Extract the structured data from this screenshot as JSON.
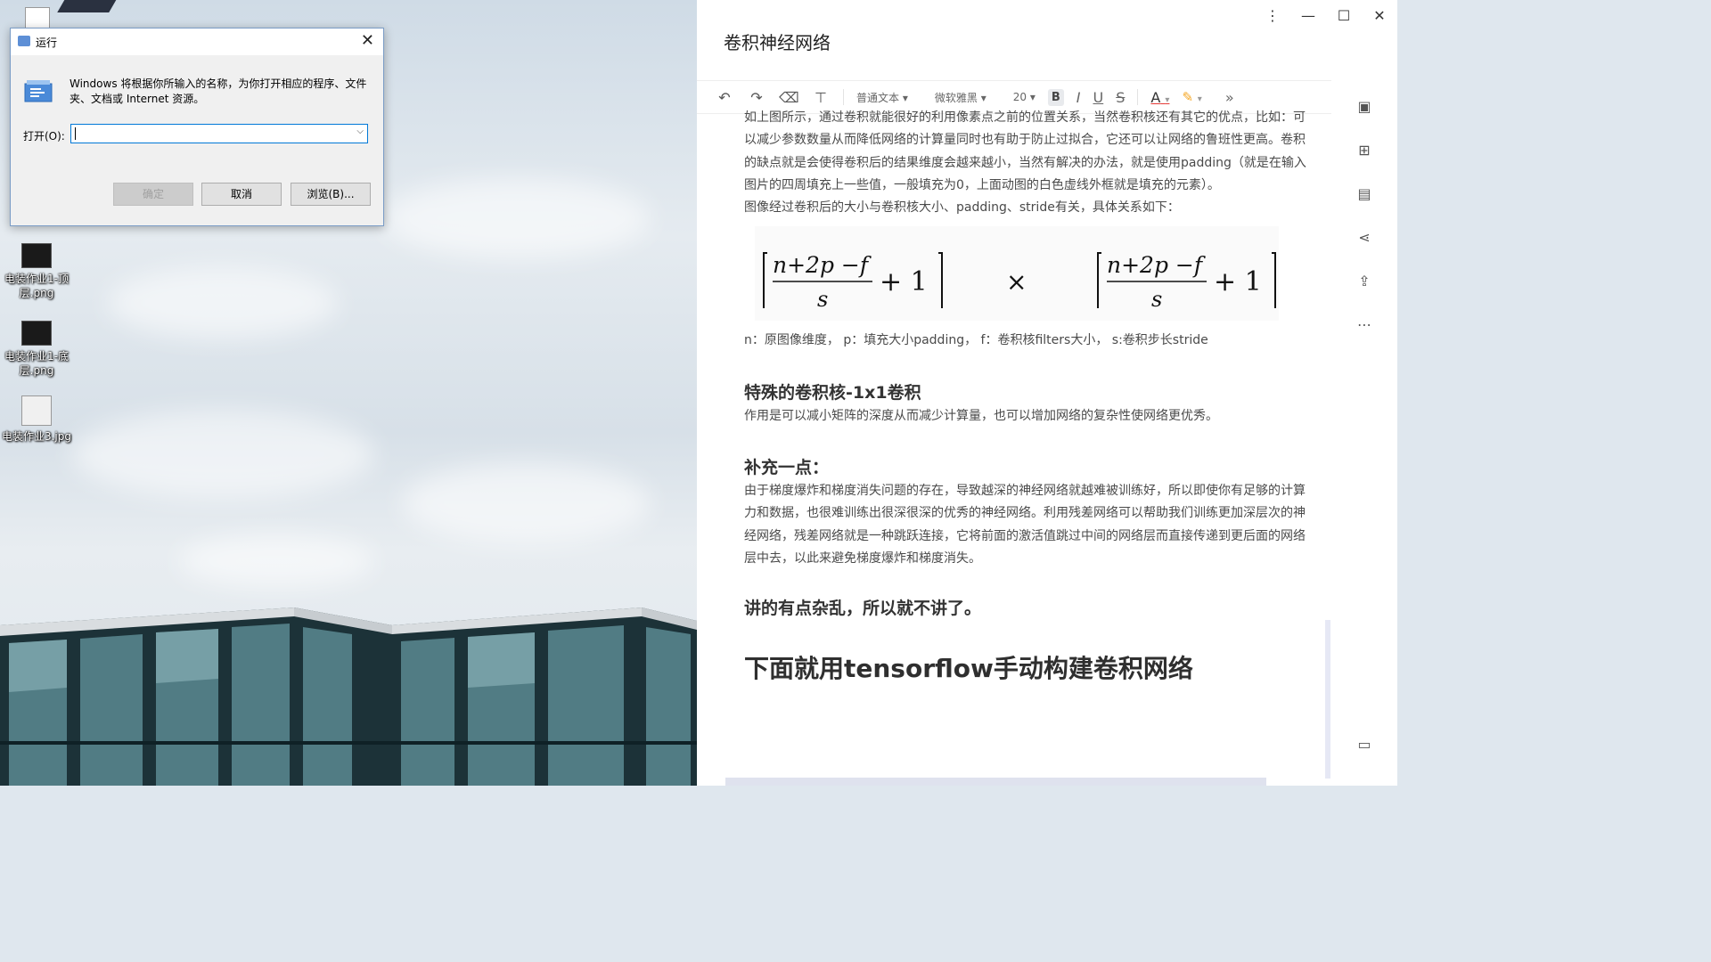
{
  "run_dialog": {
    "title": "运行",
    "description": "Windows 将根据你所输入的名称，为你打开相应的程序、文件夹、文档或 Internet 资源。",
    "open_label": "打开(O):",
    "input_value": "",
    "buttons": {
      "ok": "确定",
      "cancel": "取消",
      "browse": "浏览(B)..."
    }
  },
  "desktop": {
    "icons": [
      {
        "label": "电装作业1-顶层.png"
      },
      {
        "label": "电装作业1-底层.png"
      },
      {
        "label": "电装作业3.jpg"
      }
    ]
  },
  "editor": {
    "title": "卷积神经网络",
    "toolbar": {
      "undo": "↶",
      "redo": "↷",
      "paragraph_style": "普通文本",
      "font_family": "微软雅黑",
      "font_size": "20",
      "bold": "B",
      "italic": "I",
      "underline": "U",
      "strike": "S",
      "font_color": "A",
      "more": "»"
    },
    "content": {
      "para1": "如上图所示，通过卷积就能很好的利用像素点之前的位置关系，当然卷积核还有其它的优点，比如：可以减少参数数量从而降低网络的计算量同时也有助于防止过拟合，它还可以让网络的鲁班性更高。卷积的缺点就是会使得卷积后的结果维度会越来越小，当然有解决的办法，就是使用padding（就是在输入图片的四周填充上一些值，一般填充为0，上面动图的白色虚线外框就是填充的元素）。",
      "para2": "图像经过卷积后的大小与卷积核大小、padding、stride有关，具体关系如下：",
      "formula": {
        "numerator": "n+2p −f",
        "denominator": "s",
        "plus_one": "+ 1",
        "times": "×"
      },
      "legend": "n：原图像维度，   p：填充大小padding，   f：卷积核filters大小，   s:卷积步长stride",
      "h_special": "特殊的卷积核-1x1卷积",
      "para_special": "作用是可以减小矩阵的深度从而减少计算量，也可以增加网络的复杂性使网络更优秀。",
      "h_supplement": "补充一点：",
      "para_supplement": "由于梯度爆炸和梯度消失问题的存在，导致越深的神经网络就越难被训练好，所以即使你有足够的计算力和数据，也很难训练出很深很深的优秀的神经网络。利用残差网络可以帮助我们训练更加深层次的神经网络，残差网络就是一种跳跃连接，它将前面的激活值跳过中间的网络层而直接传递到更后面的网络层中去，以此来避免梯度爆炸和梯度消失。",
      "h_messy": "讲的有点杂乱，所以就不讲了。",
      "h_tensorflow": "下面就用tensorflow手动构建卷积网络"
    }
  }
}
